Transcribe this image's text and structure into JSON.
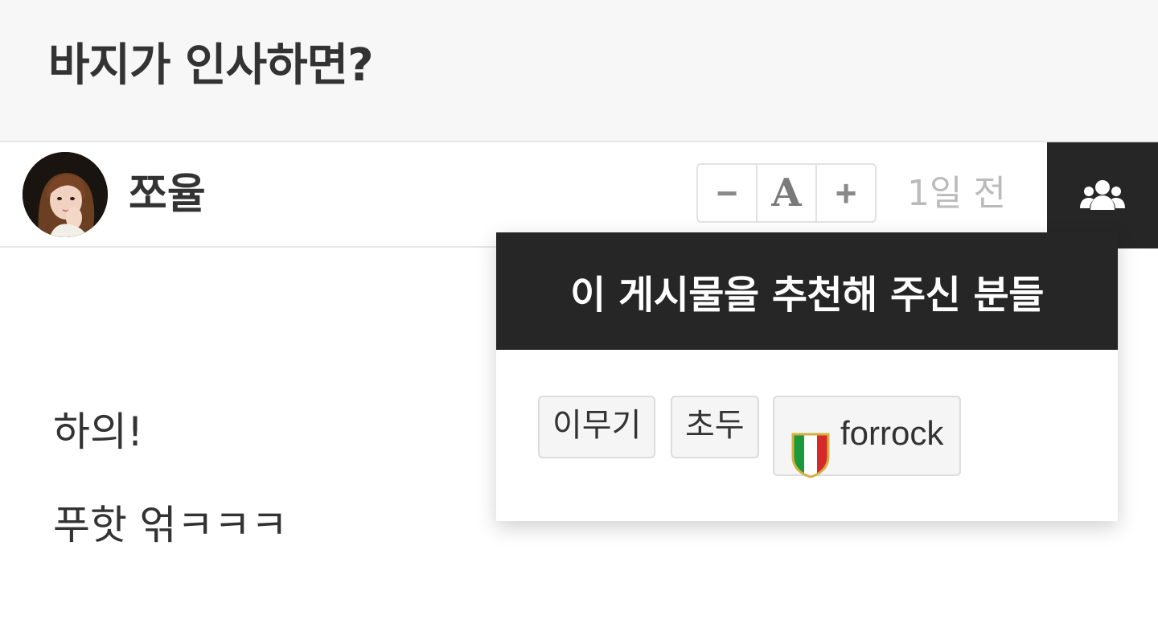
{
  "post": {
    "title": "바지가 인사하면?",
    "author": "쪼율",
    "time_ago": "1일 전",
    "content": [
      "하의!",
      "푸핫 얶ㅋㅋㅋ"
    ]
  },
  "font_size_control": {
    "decrease": "−",
    "label": "A",
    "increase": "+"
  },
  "recommenders_popup": {
    "title": "이 게시물을 추천해 주신 분들",
    "users": [
      "이무기",
      "초두",
      "forrock"
    ]
  },
  "icons": {
    "recommenders_toggle": "users-group-icon",
    "avatar": "profile-photo",
    "badge": "italian-flag-shield-icon"
  },
  "colors": {
    "title_bg": "#f7f7f7",
    "dark_header": "#262626",
    "chip_bg": "#f5f5f5",
    "muted_text": "#bbbbbb"
  }
}
